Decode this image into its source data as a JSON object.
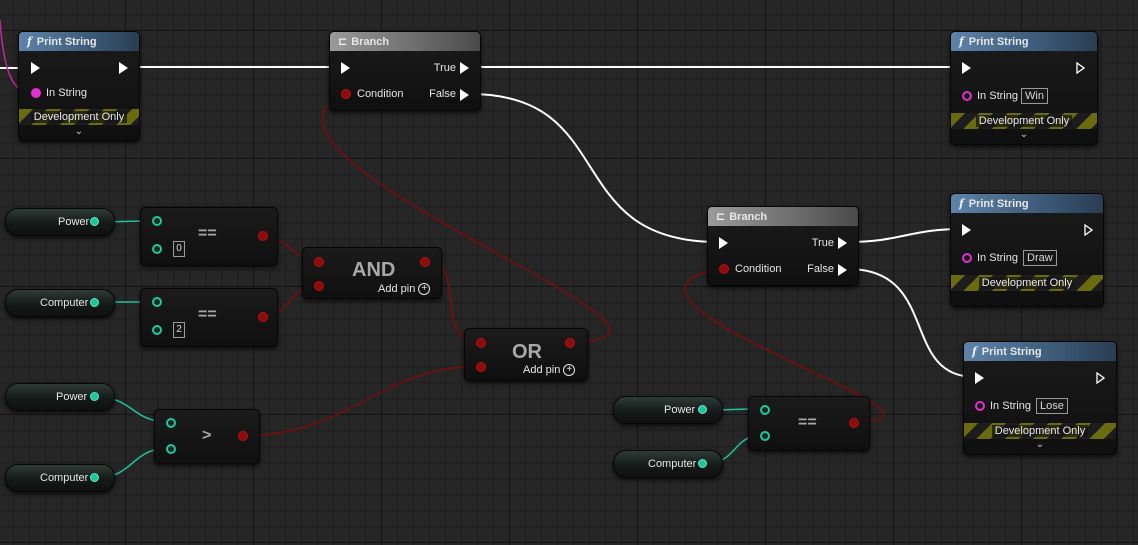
{
  "nodes": {
    "print_string_1": {
      "title": "Print String",
      "in_string_label": "In String",
      "dev_only": "Development Only"
    },
    "branch_1": {
      "title": "Branch",
      "condition_label": "Condition",
      "true_label": "True",
      "false_label": "False"
    },
    "print_string_win": {
      "title": "Print String",
      "in_string_label": "In String",
      "in_string_value": "Win",
      "dev_only": "Development Only"
    },
    "branch_2": {
      "title": "Branch",
      "condition_label": "Condition",
      "true_label": "True",
      "false_label": "False"
    },
    "print_string_draw": {
      "title": "Print String",
      "in_string_label": "In String",
      "in_string_value": "Draw",
      "dev_only": "Development Only"
    },
    "print_string_lose": {
      "title": "Print String",
      "in_string_label": "In String",
      "in_string_value": "Lose",
      "dev_only": "Development Only"
    },
    "equal_1": {
      "op": "==",
      "b_value": "0"
    },
    "equal_2": {
      "op": "==",
      "b_value": "2"
    },
    "and_node": {
      "op": "AND",
      "add_pin": "Add pin"
    },
    "or_node": {
      "op": "OR",
      "add_pin": "Add pin"
    },
    "greater_node": {
      "op": ">"
    },
    "equal_3": {
      "op": "=="
    }
  },
  "variables": {
    "power_1": "Power",
    "computer_1": "Computer",
    "power_2": "Power",
    "computer_2": "Computer",
    "power_3": "Power",
    "computer_3": "Computer"
  },
  "colors": {
    "exec_wire": "#ffffff",
    "bool_wire": "#7a0d0d",
    "int_wire": "#20c49a",
    "string_pin": "#e42ed3",
    "function_header": "#4a6f94"
  },
  "icons": {
    "function": "function-icon",
    "branch": "branch-icon",
    "add": "add-pin-icon",
    "expand": "chevron-down-icon"
  }
}
